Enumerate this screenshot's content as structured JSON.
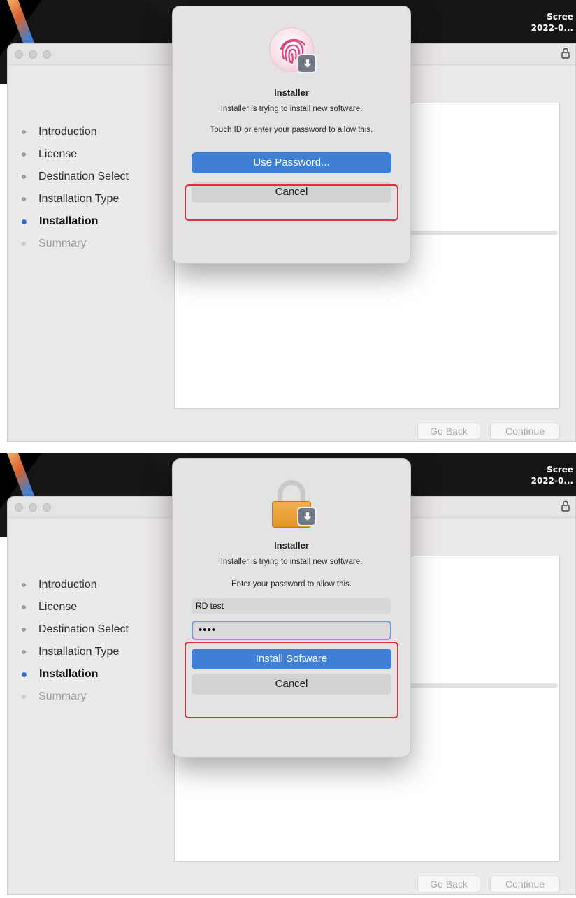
{
  "screens": [
    {
      "screenshot_label": [
        "Scree",
        "2022-0..."
      ],
      "steps": [
        {
          "label": "Introduction",
          "state": "done"
        },
        {
          "label": "License",
          "state": "done"
        },
        {
          "label": "Destination Select",
          "state": "done"
        },
        {
          "label": "Installation Type",
          "state": "done"
        },
        {
          "label": "Installation",
          "state": "active"
        },
        {
          "label": "Summary",
          "state": "pending"
        }
      ],
      "progress": 0,
      "buttons": {
        "back": "Go Back",
        "continue": "Continue"
      },
      "dialog": {
        "icon": "fingerprint-icon",
        "title": "Installer",
        "message": "Installer is trying to install new software.",
        "sub": "Touch ID or enter your password to allow this.",
        "primary": "Use Password...",
        "cancel": "Cancel"
      }
    },
    {
      "screenshot_label": [
        "Scree",
        "2022-0..."
      ],
      "steps": [
        {
          "label": "Introduction",
          "state": "done"
        },
        {
          "label": "License",
          "state": "done"
        },
        {
          "label": "Destination Select",
          "state": "done"
        },
        {
          "label": "Installation Type",
          "state": "done"
        },
        {
          "label": "Installation",
          "state": "active"
        },
        {
          "label": "Summary",
          "state": "pending"
        }
      ],
      "progress": 0.07,
      "buttons": {
        "back": "Go Back",
        "continue": "Continue"
      },
      "dialog": {
        "icon": "lock-icon",
        "title": "Installer",
        "message": "Installer is trying to install new software.",
        "sub": "Enter your password to allow this.",
        "username": "RD test",
        "password": "••••",
        "primary": "Install Software",
        "cancel": "Cancel"
      }
    }
  ],
  "colors": {
    "accent": "#3f7fd4",
    "highlight": "#e0303a"
  }
}
